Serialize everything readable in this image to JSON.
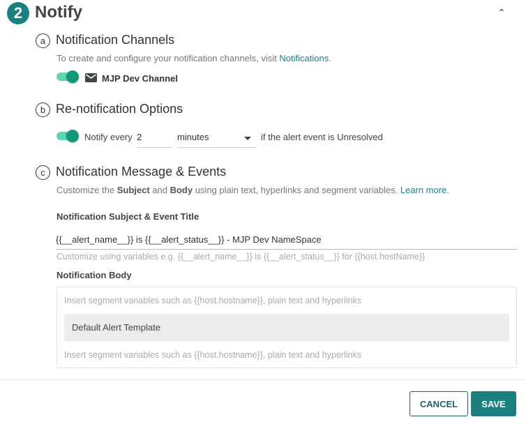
{
  "header": {
    "step": "2",
    "title": "Notify",
    "collapse_icon": "chevron-up-icon"
  },
  "channels": {
    "badge": "a",
    "title": "Notification Channels",
    "desc": "To create and configure your notification channels, visit ",
    "link": "Notifications",
    "desc_end": ".",
    "toggle_on": true,
    "channel_icon": "mail-icon",
    "channel_name": "MJP Dev Channel"
  },
  "renotify": {
    "badge": "b",
    "title": "Re-notification Options",
    "toggle_on": true,
    "prefix": "Notify every",
    "value": "2",
    "unit": "minutes",
    "suffix": "if the alert event is Unresolved"
  },
  "message": {
    "badge": "c",
    "title": "Notification Message & Events",
    "desc_1": "Customize the ",
    "desc_subject": "Subject",
    "desc_2": " and ",
    "desc_body": "Body",
    "desc_3": " using plain text, hyperlinks and segment variables. ",
    "learn_more": "Learn more.",
    "subject_label": "Notification Subject & Event Title",
    "subject_value": "{{__alert_name__}} is {{__alert_status__}} - MJP Dev NameSpace",
    "subject_help": "Customize using variables e.g. {{__alert_name__}} is {{__alert_status__}} for {{host.hostName}}",
    "body_label": "Notification Body",
    "body_placeholder_top": "Insert segment variables such as {{host.hostname}}, plain text and hyperlinks",
    "template": "Default Alert Template",
    "body_placeholder_bottom": "Insert segment variables such as {{host.hostname}}, plain text and hyperlinks"
  },
  "footer": {
    "cancel": "CANCEL",
    "save": "SAVE"
  },
  "colors": {
    "accent": "#1b7f7f",
    "toggle_track": "#5ed6b4",
    "toggle_knob": "#11987a"
  }
}
